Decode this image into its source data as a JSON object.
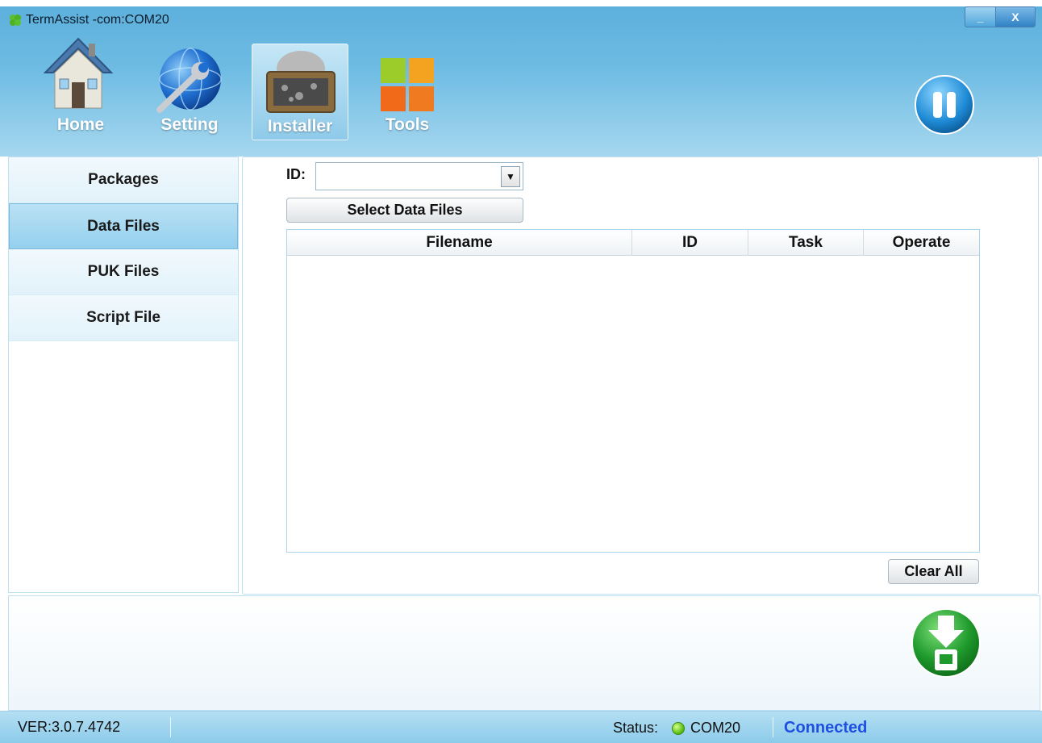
{
  "window": {
    "title": "TermAssist -com:COM20",
    "minimize_label": "_",
    "close_label": "X"
  },
  "toolbar": {
    "items": [
      {
        "label": "Home",
        "icon": "house-icon"
      },
      {
        "label": "Setting",
        "icon": "globe-wrench-icon"
      },
      {
        "label": "Installer",
        "icon": "installer-box-icon",
        "active": true
      },
      {
        "label": "Tools",
        "icon": "tools-tiles-icon"
      }
    ],
    "pause_icon": "pause-icon"
  },
  "sidebar": {
    "items": [
      {
        "label": "Packages"
      },
      {
        "label": "Data Files",
        "active": true
      },
      {
        "label": "PUK Files"
      },
      {
        "label": "Script File"
      }
    ]
  },
  "main": {
    "id_label": "ID:",
    "id_value": "",
    "select_button": "Select Data Files",
    "columns": [
      "Filename",
      "ID",
      "Task",
      "Operate"
    ],
    "rows": [],
    "clear_button": "Clear All"
  },
  "bottom": {
    "download_icon": "download-device-icon"
  },
  "status": {
    "version": "VER:3.0.7.4742",
    "label": "Status:",
    "port": "COM20",
    "connection": "Connected",
    "dot_color": "#62c21a",
    "connection_color": "#1f4fe0"
  },
  "colors": {
    "header": "#6dbbe3",
    "active_item": "#95d0ee"
  }
}
